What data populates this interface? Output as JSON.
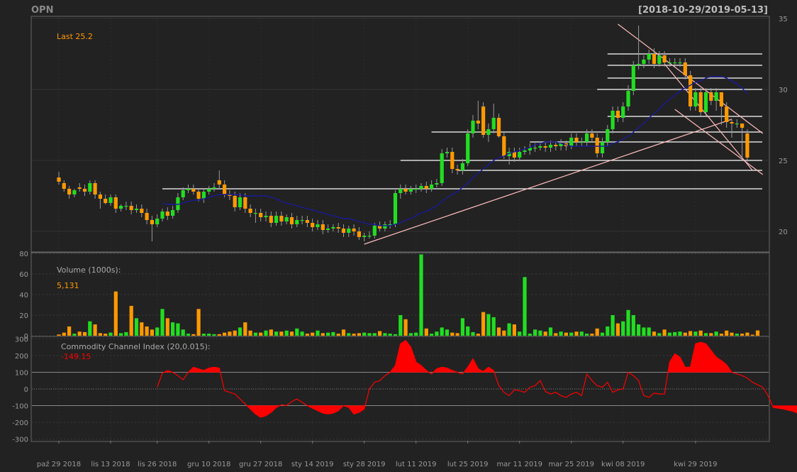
{
  "header": {
    "symbol": "OPN",
    "range": "[2018-10-29/2019-05-13]"
  },
  "colors": {
    "background": "#222222",
    "panel_border": "#777777",
    "up": "#22dd22",
    "down": "#ff9900",
    "ma_line": "#1a1a9a",
    "trendline": "#ffbbbb",
    "sr_line": "#ffffff",
    "cci": "#ff0000",
    "label_orange": "#ff9900",
    "label_gray": "#aaaaaa"
  },
  "chart_data": [
    {
      "type": "candlestick",
      "name": "price",
      "annotation_label": "Last 25.2",
      "y_ticks": [
        "20",
        "25",
        "30",
        "35"
      ],
      "ylim": [
        18.6,
        35.1
      ],
      "x_labels": [
        "paź 29 2018",
        "lis 13 2018",
        "lis 26 2018",
        "gru 10 2018",
        "gru 27 2018",
        "sty 14 2019",
        "sty 28 2019",
        "lut 11 2019",
        "lut 25 2019",
        "mar 11 2019",
        "mar 25 2019",
        "kwi 08 2019",
        "kwi 29 2019"
      ],
      "x_label_index": [
        0,
        10,
        19,
        29,
        39,
        49,
        59,
        69,
        79,
        89,
        99,
        109,
        123
      ],
      "close": [
        23.5,
        23.0,
        22.6,
        22.9,
        23.0,
        22.8,
        23.4,
        22.6,
        22.3,
        22.0,
        22.4,
        21.6,
        21.8,
        21.8,
        21.5,
        21.6,
        21.3,
        20.8,
        20.5,
        20.9,
        21.4,
        21.1,
        21.5,
        22.4,
        22.9,
        23.0,
        22.8,
        22.3,
        22.8,
        23.0,
        23.1,
        23.3,
        22.6,
        22.5,
        21.7,
        22.4,
        21.6,
        21.3,
        21.3,
        21.0,
        21.1,
        20.6,
        21.1,
        20.7,
        21.0,
        20.5,
        20.8,
        20.8,
        20.6,
        20.3,
        20.5,
        20.1,
        20.2,
        20.3,
        20.2,
        19.9,
        20.2,
        20.0,
        19.6,
        19.7,
        19.7,
        20.4,
        20.2,
        20.5,
        20.5,
        22.7,
        23.0,
        22.8,
        23.0,
        23.0,
        23.2,
        23.0,
        23.3,
        23.4,
        25.5,
        25.6,
        24.4,
        24.3,
        24.8,
        26.9,
        27.8,
        27.6,
        26.8,
        27.2,
        28.0,
        26.7,
        25.3,
        25.6,
        25.2,
        25.6,
        25.7,
        25.9,
        25.9,
        26.0,
        25.9,
        26.1,
        26.0,
        26.2,
        26.0,
        26.6,
        26.3,
        26.3,
        26.9,
        26.6,
        25.5,
        26.3,
        27.2,
        28.5,
        28.0,
        28.8,
        29.9,
        31.7,
        31.8,
        32.1,
        32.5,
        31.8,
        32.4,
        31.9,
        31.9,
        31.9,
        31.9,
        31.0,
        28.8,
        29.8,
        28.4,
        29.8,
        29.2,
        29.8,
        28.8,
        27.7,
        27.6,
        27.6,
        27.3,
        25.2
      ],
      "open": [
        23.8,
        23.4,
        23.0,
        22.6,
        23.1,
        23.0,
        22.8,
        23.4,
        22.6,
        22.3,
        22.0,
        22.4,
        21.6,
        21.8,
        21.8,
        21.5,
        21.6,
        21.3,
        20.8,
        20.5,
        20.9,
        21.4,
        21.1,
        21.5,
        22.4,
        22.9,
        23.0,
        22.8,
        22.3,
        22.8,
        23.0,
        23.6,
        23.3,
        22.6,
        22.5,
        21.7,
        22.4,
        21.6,
        21.3,
        21.3,
        21.0,
        21.1,
        20.6,
        21.1,
        20.7,
        21.0,
        20.5,
        20.8,
        20.8,
        20.6,
        20.3,
        20.5,
        20.1,
        20.2,
        20.3,
        20.2,
        19.9,
        20.2,
        20.0,
        19.6,
        19.7,
        19.7,
        20.4,
        20.2,
        20.5,
        20.5,
        22.7,
        23.0,
        22.8,
        23.0,
        23.0,
        23.2,
        23.0,
        23.3,
        23.4,
        25.5,
        25.6,
        24.4,
        24.3,
        24.8,
        26.9,
        27.8,
        28.8,
        26.8,
        27.2,
        28.0,
        26.7,
        25.3,
        25.6,
        25.2,
        25.6,
        25.7,
        25.9,
        25.9,
        26.0,
        25.9,
        26.1,
        26.0,
        26.2,
        26.0,
        26.6,
        26.3,
        26.3,
        26.9,
        26.6,
        25.5,
        26.3,
        27.2,
        28.5,
        28.0,
        28.8,
        29.9,
        31.7,
        31.8,
        32.1,
        32.5,
        31.8,
        32.4,
        31.9,
        31.9,
        31.9,
        31.9,
        31.0,
        28.8,
        29.8,
        28.4,
        29.8,
        29.2,
        29.8,
        28.8,
        27.7,
        27.6,
        27.6,
        26.9
      ],
      "high": [
        24.2,
        23.6,
        23.2,
        23.0,
        23.4,
        23.3,
        23.6,
        23.6,
        22.8,
        22.6,
        22.6,
        22.6,
        21.9,
        22.1,
        22.1,
        21.9,
        21.9,
        21.6,
        21.1,
        21.2,
        21.6,
        21.7,
        21.8,
        22.7,
        23.1,
        23.3,
        23.3,
        23.0,
        23.0,
        23.2,
        23.4,
        24.3,
        23.6,
        22.9,
        22.8,
        22.7,
        22.7,
        21.9,
        21.6,
        21.6,
        21.4,
        21.4,
        21.4,
        21.4,
        21.2,
        21.3,
        21.1,
        21.1,
        21.1,
        20.9,
        20.8,
        20.8,
        20.5,
        20.5,
        20.6,
        20.5,
        20.4,
        20.5,
        20.3,
        19.9,
        20.0,
        20.6,
        20.7,
        20.7,
        20.8,
        22.9,
        23.3,
        23.3,
        23.2,
        23.3,
        23.4,
        23.5,
        23.6,
        23.7,
        25.8,
        25.9,
        25.9,
        24.7,
        25.1,
        27.2,
        28.2,
        29.2,
        29.1,
        27.6,
        29.0,
        28.3,
        27.0,
        25.9,
        25.9,
        25.9,
        26.0,
        26.2,
        26.2,
        26.3,
        26.3,
        26.4,
        26.3,
        26.5,
        26.4,
        26.9,
        26.9,
        26.6,
        27.2,
        27.2,
        26.9,
        26.6,
        27.5,
        28.8,
        28.8,
        29.1,
        30.3,
        32.0,
        34.5,
        32.4,
        32.8,
        32.9,
        32.7,
        32.7,
        32.2,
        32.2,
        32.2,
        32.2,
        31.3,
        30.1,
        30.1,
        30.1,
        30.1,
        30.1,
        29.4,
        29.1,
        27.9,
        27.9,
        27.6,
        27.2
      ],
      "low": [
        23.3,
        22.8,
        22.3,
        22.4,
        22.8,
        22.5,
        22.6,
        22.3,
        21.6,
        21.9,
        21.8,
        21.3,
        21.4,
        21.5,
        21.2,
        21.3,
        21.0,
        20.5,
        19.3,
        20.3,
        20.7,
        20.8,
        20.9,
        21.3,
        22.2,
        22.7,
        22.6,
        22.1,
        22.0,
        22.6,
        22.8,
        23.0,
        22.4,
        22.2,
        21.4,
        21.5,
        21.3,
        21.0,
        20.6,
        20.7,
        20.7,
        20.3,
        20.4,
        20.4,
        20.5,
        20.2,
        20.3,
        20.5,
        20.3,
        20.0,
        20.1,
        19.8,
        19.9,
        20.0,
        19.9,
        19.6,
        19.6,
        19.7,
        19.4,
        19.3,
        19.5,
        19.5,
        20.0,
        20.0,
        20.2,
        20.3,
        22.3,
        22.6,
        22.6,
        22.7,
        22.8,
        22.7,
        22.8,
        23.1,
        23.2,
        25.2,
        24.1,
        24.0,
        24.0,
        24.6,
        26.6,
        27.2,
        26.6,
        26.3,
        26.9,
        26.6,
        25.1,
        24.7,
        24.9,
        25.0,
        25.4,
        25.4,
        25.6,
        25.7,
        25.6,
        25.6,
        25.7,
        25.7,
        25.7,
        25.8,
        26.0,
        26.0,
        26.0,
        26.3,
        25.2,
        25.2,
        26.0,
        26.9,
        27.7,
        27.7,
        28.5,
        29.6,
        31.4,
        31.5,
        31.8,
        31.5,
        31.6,
        31.6,
        31.6,
        31.6,
        31.6,
        30.7,
        28.5,
        28.5,
        28.1,
        28.1,
        28.9,
        28.5,
        27.5,
        27.3,
        26.6,
        27.3,
        25.0,
        24.9
      ],
      "moving_average": [
        null,
        null,
        null,
        null,
        null,
        null,
        null,
        null,
        null,
        null,
        null,
        null,
        null,
        null,
        null,
        null,
        null,
        null,
        null,
        null,
        22.0,
        21.9,
        21.9,
        21.9,
        22.0,
        22.1,
        22.2,
        22.2,
        22.3,
        22.4,
        22.5,
        22.6,
        22.6,
        22.6,
        22.6,
        22.6,
        22.5,
        22.5,
        22.5,
        22.5,
        22.5,
        22.4,
        22.3,
        22.1,
        22.0,
        21.9,
        21.8,
        21.7,
        21.6,
        21.5,
        21.4,
        21.3,
        21.2,
        21.1,
        21.0,
        20.9,
        20.9,
        20.8,
        20.7,
        20.6,
        20.5,
        20.5,
        20.4,
        20.4,
        20.4,
        20.5,
        20.6,
        20.8,
        20.9,
        21.1,
        21.3,
        21.4,
        21.6,
        21.8,
        22.1,
        22.4,
        22.6,
        22.8,
        23.1,
        23.4,
        23.8,
        24.1,
        24.4,
        24.7,
        25.0,
        25.2,
        25.3,
        25.5,
        25.6,
        25.7,
        25.8,
        25.9,
        26.1,
        26.2,
        26.3,
        26.3,
        26.3,
        26.2,
        26.1,
        26.0,
        26.0,
        26.0,
        26.0,
        26.0,
        26.0,
        26.0,
        26.0,
        26.2,
        26.3,
        26.5,
        26.7,
        27.0,
        27.3,
        27.6,
        28.0,
        28.3,
        28.6,
        29.0,
        29.3,
        29.6,
        29.9,
        30.1,
        30.3,
        30.5,
        30.6,
        30.8,
        30.9,
        30.9,
        30.9,
        30.8,
        30.6,
        30.4,
        30.1,
        29.7
      ],
      "trendlines": [
        {
          "x": [
            59,
            130
          ],
          "y": [
            19.1,
            27.9
          ]
        },
        {
          "x": [
            108,
            136
          ],
          "y": [
            34.6,
            26.9
          ]
        },
        {
          "x": [
            117,
            134
          ],
          "y": [
            31.8,
            24.3
          ]
        },
        {
          "x": [
            119,
            136
          ],
          "y": [
            28.6,
            24.0
          ]
        }
      ],
      "levels": [
        {
          "y": 23.0,
          "from": 20
        },
        {
          "y": 24.3,
          "from": 77
        },
        {
          "y": 25.0,
          "from": 66
        },
        {
          "y": 26.3,
          "from": 91
        },
        {
          "y": 27.0,
          "from": 72
        },
        {
          "y": 28.1,
          "from": 106
        },
        {
          "y": 30.0,
          "from": 104
        },
        {
          "y": 30.8,
          "from": 106
        },
        {
          "y": 31.7,
          "from": 106
        },
        {
          "y": 32.5,
          "from": 106
        }
      ]
    },
    {
      "type": "bar",
      "name": "volume",
      "panel_label": "Volume (1000s):",
      "last_value_label": "5,131",
      "y_ticks": [
        "0",
        "20",
        "40",
        "60",
        "80"
      ],
      "ylim": [
        0,
        80
      ],
      "values": [
        1.2,
        3.0,
        9.0,
        2.0,
        4.0,
        3.5,
        14.0,
        11.0,
        2.5,
        2.0,
        3.0,
        43.0,
        2.5,
        3.5,
        29.0,
        17.0,
        13.0,
        9.0,
        6.0,
        8.0,
        26.0,
        17.0,
        13.0,
        12.0,
        6.0,
        2.0,
        1.5,
        26.0,
        2.0,
        2.0,
        1.5,
        1.5,
        3.0,
        4.0,
        5.0,
        8.0,
        13.0,
        5.0,
        3.0,
        3.0,
        5.0,
        6.0,
        4.0,
        4.0,
        5.0,
        4.0,
        7.0,
        4.0,
        2.0,
        3.0,
        5.0,
        2.5,
        3.0,
        3.5,
        2.0,
        6.0,
        2.5,
        2.0,
        2.5,
        3.0,
        2.5,
        2.5,
        4.5,
        2.5,
        2.0,
        1.5,
        20.0,
        16.0,
        2.5,
        3.0,
        79.0,
        7.0,
        2.0,
        4.0,
        8.0,
        6.0,
        3.0,
        2.5,
        17.0,
        9.0,
        3.5,
        2.0,
        23.0,
        21.0,
        18.0,
        8.0,
        5.0,
        12.0,
        11.0,
        4.0,
        57.0,
        2.0,
        6.0,
        5.0,
        4.0,
        8.0,
        2.5,
        4.0,
        3.0,
        3.0,
        4.0,
        4.0,
        2.0,
        2.0,
        7.0,
        3.0,
        9.0,
        20.0,
        12.0,
        14.0,
        25.0,
        20.0,
        11.0,
        8.0,
        8.0,
        4.0,
        2.5,
        6.0,
        3.0,
        3.5,
        4.0,
        3.0,
        4.5,
        4.0,
        5.0,
        2.5,
        2.5,
        4.0,
        2.0,
        5.0,
        3.0,
        2.0,
        2.0,
        3.0,
        1.0,
        5.131
      ],
      "colors_by_direction": true
    },
    {
      "type": "area",
      "name": "cci",
      "panel_label": "Commodity Channel Index (20,0.015):",
      "last_value_label": "-149.15",
      "y_ticks": [
        "-300",
        "-200",
        "-100",
        "0",
        "100",
        "200",
        "300"
      ],
      "ylim": [
        -310,
        310
      ],
      "upper_level": 100,
      "lower_level": -100,
      "start_index": 19,
      "values": [
        10,
        95,
        110,
        100,
        80,
        55,
        100,
        130,
        120,
        110,
        125,
        130,
        125,
        -10,
        -20,
        -30,
        -60,
        -90,
        -120,
        -150,
        -170,
        -160,
        -140,
        -110,
        -95,
        -100,
        -75,
        -60,
        -80,
        -100,
        -115,
        -130,
        -145,
        -150,
        -145,
        -130,
        -100,
        -110,
        -150,
        -140,
        -120,
        0,
        40,
        50,
        80,
        100,
        140,
        270,
        290,
        250,
        160,
        140,
        110,
        90,
        120,
        130,
        125,
        110,
        100,
        90,
        130,
        180,
        120,
        105,
        130,
        110,
        20,
        -20,
        -40,
        -5,
        -10,
        -20,
        10,
        20,
        50,
        -15,
        -30,
        -20,
        -40,
        -50,
        -30,
        -20,
        -40,
        90,
        50,
        20,
        10,
        40,
        -20,
        -5,
        0,
        100,
        80,
        50,
        -40,
        -50,
        -25,
        -30,
        -30,
        160,
        210,
        190,
        130,
        130,
        270,
        280,
        270,
        230,
        190,
        170,
        145,
        100,
        90,
        80,
        65,
        40,
        25,
        10,
        -40,
        -110,
        -115,
        -120,
        -128,
        -135,
        -150,
        -140,
        -110
      ]
    }
  ]
}
